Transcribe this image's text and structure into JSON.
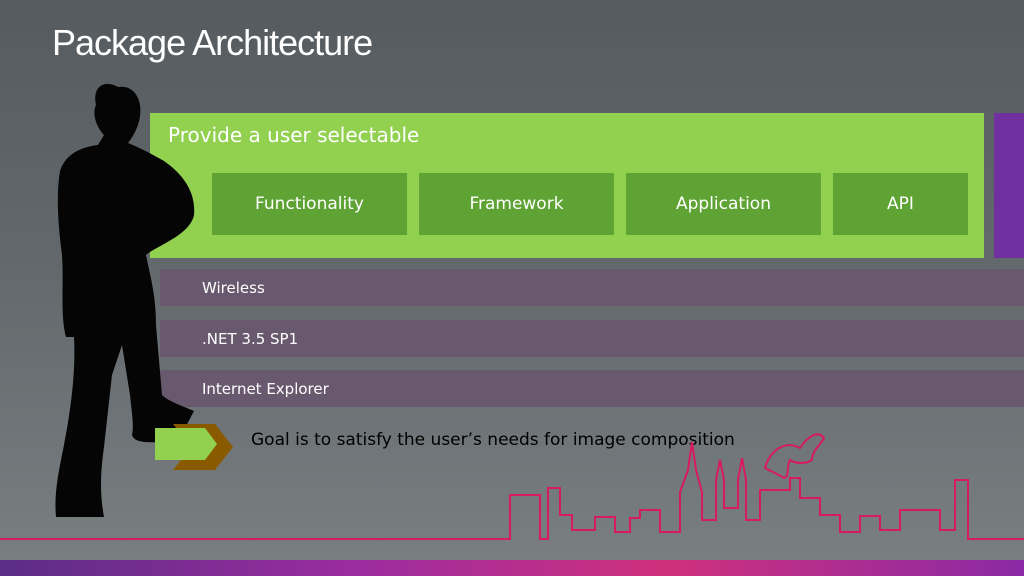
{
  "slide": {
    "title": "Package Architecture"
  },
  "panel": {
    "heading": "Provide a user selectable",
    "options": [
      "Functionality",
      "Framework",
      "Application",
      "API"
    ]
  },
  "layers": [
    "Wireless",
    ".NET 3.5 SP1",
    "Internet Explorer"
  ],
  "goal": {
    "text": "Goal is to satisfy the user’s needs for image composition"
  },
  "icons": {
    "silhouette": "person-silhouette-icon",
    "arrow": "chevron-arrow-icon",
    "skyline": "city-skyline-outline"
  },
  "colors": {
    "panel_green": "#92d050",
    "option_green": "#5ea334",
    "accent_purple": "#7030a0",
    "layer_bar": "#69596f",
    "skyline_pink": "#d81b60",
    "arrow_brown": "#8a5a00"
  }
}
